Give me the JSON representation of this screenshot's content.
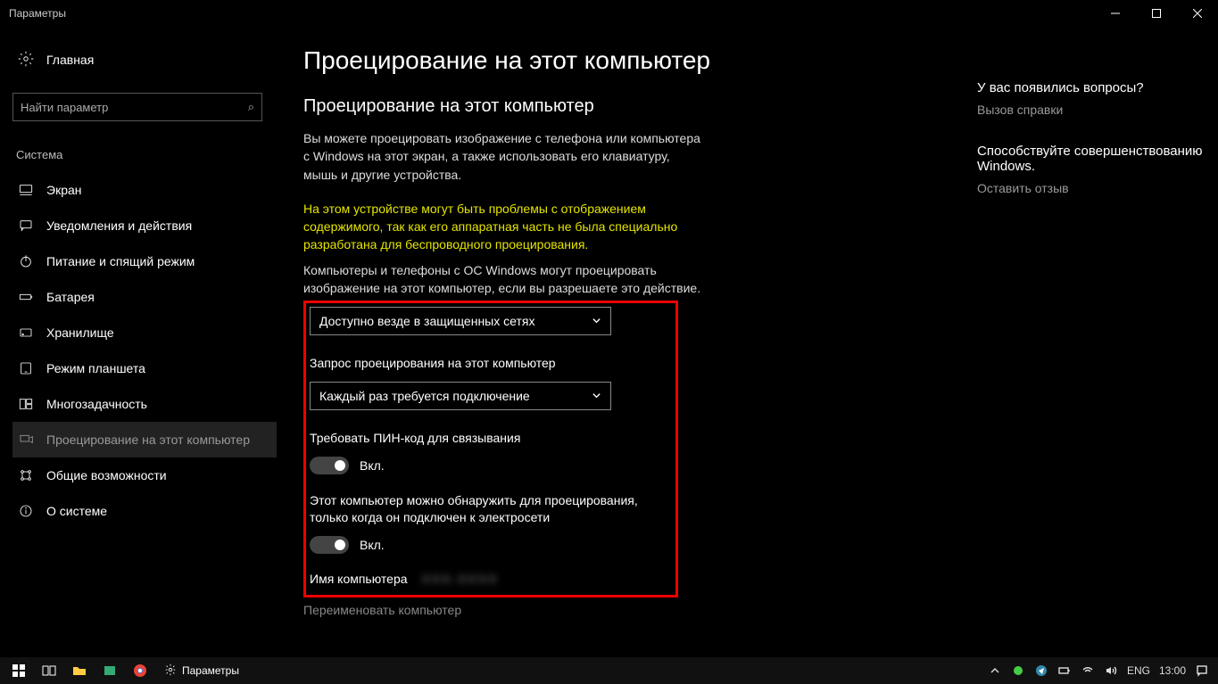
{
  "titlebar": {
    "app": "Параметры"
  },
  "sidebar": {
    "home": "Главная",
    "search_placeholder": "Найти параметр",
    "group": "Система",
    "items": [
      {
        "id": "display",
        "label": "Экран"
      },
      {
        "id": "notifications",
        "label": "Уведомления и действия"
      },
      {
        "id": "power",
        "label": "Питание и спящий режим"
      },
      {
        "id": "battery",
        "label": "Батарея"
      },
      {
        "id": "storage",
        "label": "Хранилище"
      },
      {
        "id": "tablet",
        "label": "Режим планшета"
      },
      {
        "id": "multitask",
        "label": "Многозадачность"
      },
      {
        "id": "projecting",
        "label": "Проецирование на этот компьютер",
        "active": true
      },
      {
        "id": "shared",
        "label": "Общие возможности"
      },
      {
        "id": "about",
        "label": "О системе"
      }
    ]
  },
  "main": {
    "h1": "Проецирование на этот компьютер",
    "h2": "Проецирование на этот компьютер",
    "para": "Вы можете проецировать изображение с телефона или компьютера с Windows на этот экран, а также использовать его клавиатуру, мышь и другие устройства.",
    "warning": "На этом устройстве могут быть проблемы с отображением содержимого, так как его аппаратная часть не была специально разработана для беспроводного проецирования.",
    "para2": "Компьютеры и телефоны с ОС Windows могут проецировать изображение на этот компьютер, если вы разрешаете это действие.",
    "dd1": "Доступно везде в защищенных сетях",
    "label2": "Запрос проецирования на этот компьютер",
    "dd2": "Каждый раз требуется подключение",
    "label3": "Требовать ПИН-код для связывания",
    "toggle1_state": "Вкл.",
    "label4": "Этот компьютер можно обнаружить для проецирования, только когда он подключен к электросети",
    "toggle2_state": "Вкл.",
    "pcname_label": "Имя компьютера",
    "pcname_value": "XXX-XXXX",
    "rename": "Переименовать компьютер"
  },
  "right": {
    "help_title": "У вас появились вопросы?",
    "help_link": "Вызов справки",
    "feedback_title": "Способствуйте совершенствованию Windows.",
    "feedback_link": "Оставить отзыв"
  },
  "taskbar": {
    "app_label": "Параметры",
    "lang": "ENG",
    "clock": "13:00"
  }
}
